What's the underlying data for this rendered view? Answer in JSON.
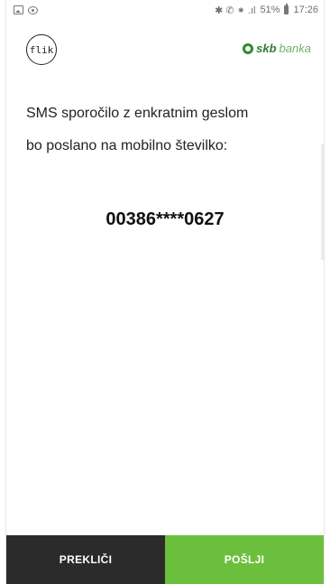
{
  "status_bar": {
    "signal_text": "✱ ✆ ⁕ .ıl",
    "battery_percent": "51%",
    "time": "17:26",
    "icons": [
      "image-icon",
      "eye-icon",
      "bluetooth-icon",
      "mute-icon",
      "wifi-icon",
      "signal-icon",
      "battery-icon"
    ]
  },
  "header": {
    "app_logo_text": "flik",
    "bank_logo_text_bold": "skb",
    "bank_logo_text_light": "banka"
  },
  "main": {
    "message_line1": "SMS sporočilo z enkratnim geslom",
    "message_line2": "bo poslano na mobilno številko:",
    "phone_number": "00386****0627"
  },
  "footer": {
    "cancel_label": "PREKLIČI",
    "send_label": "POŠLJI"
  },
  "colors": {
    "cancel_bg": "#2b2b2b",
    "send_bg": "#6cbf3c",
    "brand_green": "#2e7d32"
  }
}
